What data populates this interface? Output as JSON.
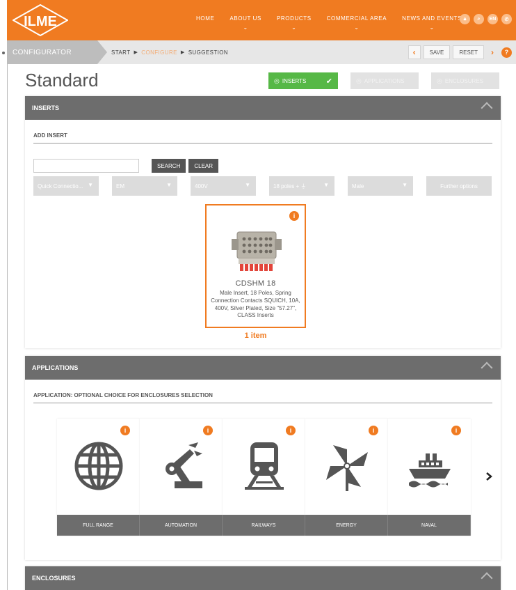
{
  "nav": {
    "items": [
      {
        "label": "HOME",
        "has_menu": false
      },
      {
        "label": "ABOUT US",
        "has_menu": true
      },
      {
        "label": "PRODUCTS",
        "has_menu": true
      },
      {
        "label": "COMMERCIAL AREA",
        "has_menu": true
      },
      {
        "label": "NEWS AND EVENTS",
        "has_menu": true
      }
    ],
    "icons": [
      "lock-icon",
      "search-icon",
      "language-icon",
      "phone-icon"
    ],
    "language": "EN",
    "accent_color": "#f07b21"
  },
  "breadcrumb": {
    "section": "CONFIGURATOR",
    "steps": [
      "START",
      "CONFIGURE",
      "SUGGESTION"
    ],
    "active_step": 1,
    "save_label": "SAVE",
    "reset_label": "RESET",
    "help_label": "?"
  },
  "page": {
    "title": "Standard",
    "steps": [
      {
        "label": "INSERTS",
        "active": true
      },
      {
        "label": "APPLICATIONS",
        "active": false
      },
      {
        "label": "ENCLOSURES",
        "active": false
      }
    ]
  },
  "inserts": {
    "header": "INSERTS",
    "subheader": "ADD INSERT",
    "search": {
      "value": "",
      "placeholder": "",
      "search_label": "SEARCH",
      "clear_label": "CLEAR"
    },
    "filters": [
      "Quick Connectio...",
      "EM",
      "400V",
      "18 poles + ⏚",
      "Male"
    ],
    "further_options": "Further options",
    "product": {
      "name": "CDSHM 18",
      "description": "Male Insert, 18 Poles, Spring Connection Contacts SQUICH, 10A, 400V, Silver Plated, Size \"57.27\", CLASS Inserts"
    },
    "count": "1 item"
  },
  "applications": {
    "header": "APPLICATIONS",
    "subheader": "APPLICATION: OPTIONAL CHOICE FOR ENCLOSURES SELECTION",
    "items": [
      {
        "label": "FULL RANGE",
        "icon": "globe-icon"
      },
      {
        "label": "AUTOMATION",
        "icon": "robot-arm-icon"
      },
      {
        "label": "RAILWAYS",
        "icon": "train-icon"
      },
      {
        "label": "ENERGY",
        "icon": "wind-turbine-icon"
      },
      {
        "label": "NAVAL",
        "icon": "ship-icon"
      }
    ]
  },
  "enclosures": {
    "header": "ENCLOSURES"
  }
}
